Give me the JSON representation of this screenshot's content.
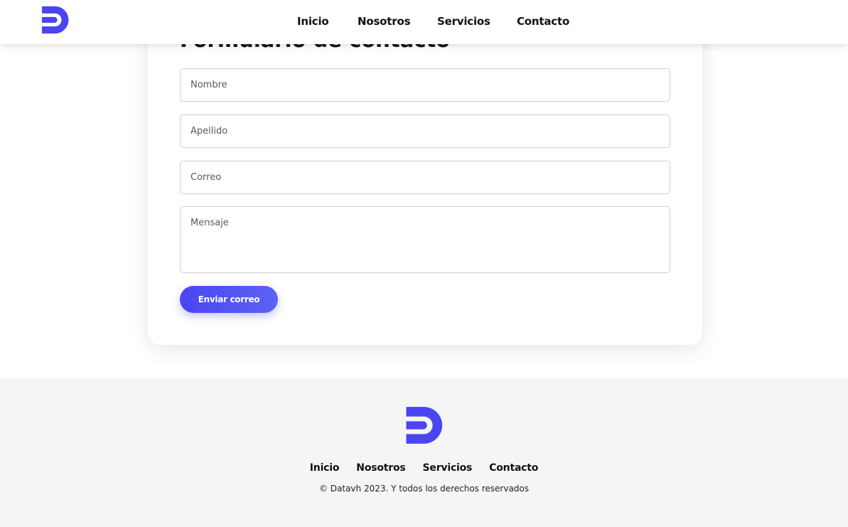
{
  "brand": {
    "logo_icon": "datavh-d-logo-icon",
    "accent_color": "#4a45f0"
  },
  "header": {
    "nav": [
      "Inicio",
      "Nosotros",
      "Servicios",
      "Contacto"
    ]
  },
  "form": {
    "title": "Formulario de contacto",
    "fields": {
      "nombre": {
        "placeholder": "Nombre",
        "value": ""
      },
      "apellido": {
        "placeholder": "Apellido",
        "value": ""
      },
      "correo": {
        "placeholder": "Correo",
        "value": ""
      },
      "mensaje": {
        "placeholder": "Mensaje",
        "value": ""
      }
    },
    "submit_label": "Enviar correo"
  },
  "footer": {
    "nav": [
      "Inicio",
      "Nosotros",
      "Servicios",
      "Contacto"
    ],
    "copyright": "© Datavh 2023. Y todos los derechos reservados",
    "background_color": "#f5f5f5"
  }
}
